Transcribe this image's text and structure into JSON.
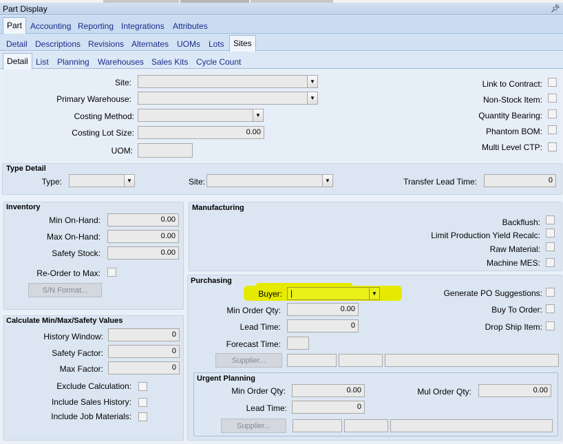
{
  "window": {
    "title": "Part Display"
  },
  "tabs_level1": [
    "Part",
    "Accounting",
    "Reporting",
    "Integrations",
    "Attributes"
  ],
  "tabs_level2": [
    "Detail",
    "Descriptions",
    "Revisions",
    "Alternates",
    "UOMs",
    "Lots",
    "Sites"
  ],
  "tabs_level3": [
    "Detail",
    "List",
    "Planning",
    "Warehouses",
    "Sales Kits",
    "Cycle Count"
  ],
  "main": {
    "site_label": "Site:",
    "primary_warehouse_label": "Primary Warehouse:",
    "costing_method_label": "Costing Method:",
    "costing_lot_size_label": "Costing Lot Size:",
    "costing_lot_size_value": "0.00",
    "uom_label": "UOM:",
    "link_to_contract_label": "Link to Contract:",
    "non_stock_label": "Non-Stock Item:",
    "quantity_bearing_label": "Quantity Bearing:",
    "phantom_bom_label": "Phantom BOM:",
    "multi_level_ctp_label": "Multi Level CTP:"
  },
  "type_detail": {
    "title": "Type Detail",
    "type_label": "Type:",
    "site_label": "Site:",
    "transfer_lead_time_label": "Transfer Lead Time:",
    "transfer_lead_time_value": "0"
  },
  "inventory": {
    "title": "Inventory",
    "min_label": "Min On-Hand:",
    "min_value": "0.00",
    "max_label": "Max On-Hand:",
    "max_value": "0.00",
    "safety_label": "Safety Stock:",
    "safety_value": "0.00",
    "reorder_label": "Re-Order to Max:",
    "sn_button": "S/N Format..."
  },
  "calc": {
    "title": "Calculate Min/Max/Safety Values",
    "history_label": "History Window:",
    "history_value": "0",
    "safety_factor_label": "Safety Factor:",
    "safety_factor_value": "0",
    "max_factor_label": "Max Factor:",
    "max_factor_value": "0",
    "exclude_label": "Exclude Calculation:",
    "include_sales_label": "Include Sales History:",
    "include_job_label": "Include Job Materials:"
  },
  "manufacturing": {
    "title": "Manufacturing",
    "backflush_label": "Backflush:",
    "limit_label": "Limit Production Yield Recalc:",
    "raw_label": "Raw Material:",
    "mes_label": "Machine MES:"
  },
  "purchasing": {
    "title": "Purchasing",
    "buyer_label": "Buyer:",
    "buyer_value": "|",
    "min_order_label": "Min Order Qty:",
    "min_order_value": "0.00",
    "lead_time_label": "Lead Time:",
    "lead_time_value": "0",
    "forecast_label": "Forecast Time:",
    "supplier_button": "Supplier...",
    "gen_po_label": "Generate PO Suggestions:",
    "buy_to_order_label": "Buy To Order:",
    "drop_ship_label": "Drop Ship Item:"
  },
  "urgent": {
    "title": "Urgent Planning",
    "min_order_label": "Min Order Qty:",
    "min_order_value": "0.00",
    "mul_order_label": "Mul Order Qty:",
    "mul_order_value": "0.00",
    "lead_time_label": "Lead Time:",
    "lead_time_value": "0",
    "supplier_button": "Supplier..."
  },
  "colors": {
    "highlight": "#e6ea00",
    "tab_text": "#1a2b8a"
  }
}
